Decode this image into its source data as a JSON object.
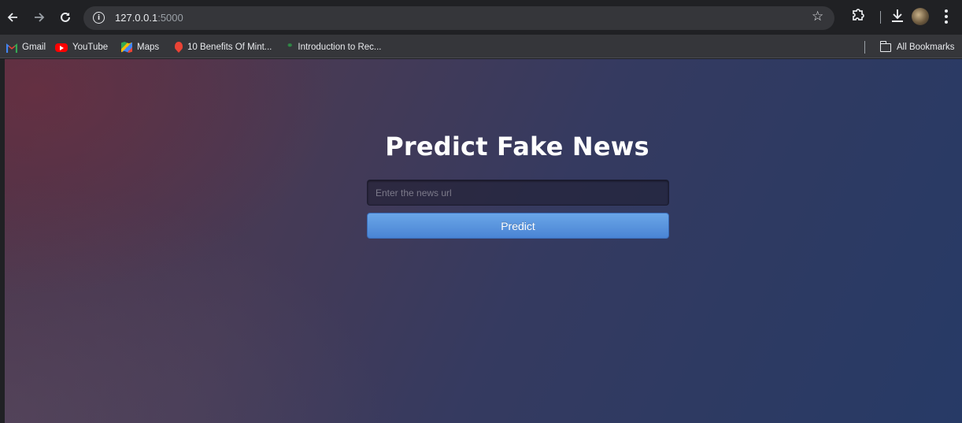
{
  "browser": {
    "url_host": "127.0.0.1",
    "url_port": ":5000",
    "icons": {
      "back": "back-arrow-icon",
      "forward": "forward-arrow-icon",
      "reload": "reload-icon",
      "site_info": "info-icon",
      "bookmark": "star-icon",
      "extensions": "puzzle-icon",
      "download": "download-icon",
      "profile": "avatar",
      "menu": "kebab-menu-icon"
    }
  },
  "bookmarks": {
    "items": [
      {
        "label": "Gmail",
        "icon": "gmail-icon"
      },
      {
        "label": "YouTube",
        "icon": "youtube-icon"
      },
      {
        "label": "Maps",
        "icon": "maps-icon"
      },
      {
        "label": "10 Benefits Of Mint...",
        "icon": "pin-icon"
      },
      {
        "label": "Introduction to Rec...",
        "icon": "gfg-icon"
      }
    ],
    "all_bookmarks": "All Bookmarks"
  },
  "page": {
    "title": "Predict Fake News",
    "input_placeholder": "Enter the news url",
    "button_label": "Predict",
    "colors": {
      "button": "#5a95de",
      "title": "#ffffff"
    }
  }
}
